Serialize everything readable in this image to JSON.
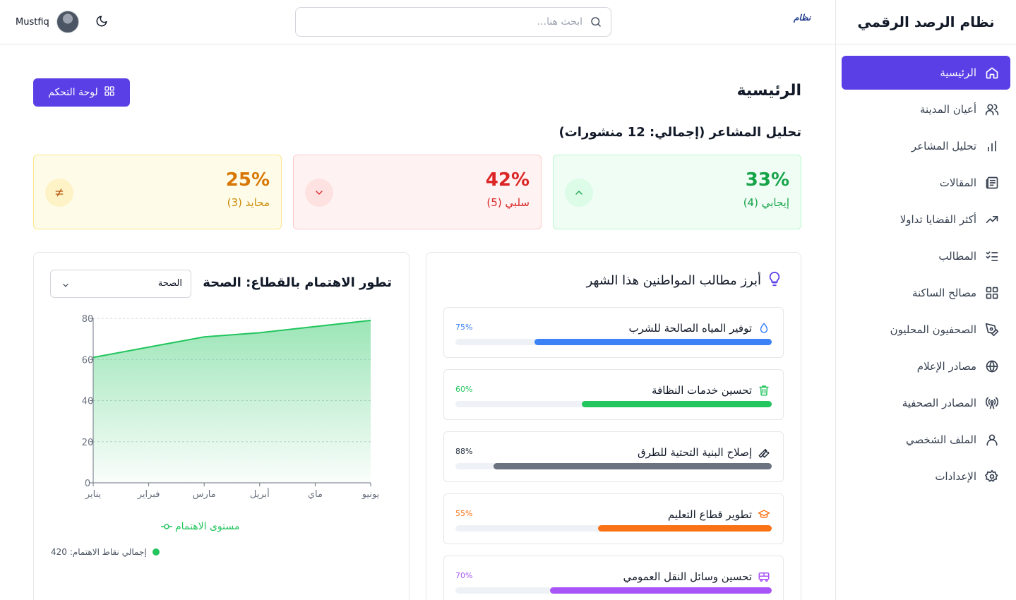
{
  "app": {
    "title": "نظام الرصد الرقمي",
    "logo_text": "نظام"
  },
  "header": {
    "search_placeholder": "ابحث هنا...",
    "user_name": "Mustfiq"
  },
  "sidebar": {
    "items": [
      {
        "label": "الرئيسية",
        "icon": "home-icon",
        "active": true
      },
      {
        "label": "أعيان المدينة",
        "icon": "users-icon"
      },
      {
        "label": "تحليل المشاعر",
        "icon": "bar-chart-icon"
      },
      {
        "label": "المقالات",
        "icon": "newspaper-icon"
      },
      {
        "label": "أكثر القضايا تداولا",
        "icon": "trending-icon"
      },
      {
        "label": "المطالب",
        "icon": "list-check-icon"
      },
      {
        "label": "مصالح الساكنة",
        "icon": "grid-icon"
      },
      {
        "label": "الصحفيون المحليون",
        "icon": "pen-icon"
      },
      {
        "label": "مصادر الإعلام",
        "icon": "globe-icon"
      },
      {
        "label": "المصادر الصحفية",
        "icon": "radio-icon"
      },
      {
        "label": "الملف الشخصي",
        "icon": "user-icon"
      },
      {
        "label": "الإعدادات",
        "icon": "gear-icon"
      }
    ]
  },
  "main": {
    "title": "الرئيسية",
    "dashboard_button": "لوحة التحكم",
    "sentiment_title": "تحليل المشاعر (إجمالي: 12 منشورات)",
    "sentiment": {
      "positive": {
        "pct": "33%",
        "label": "إيجابي (4)"
      },
      "negative": {
        "pct": "42%",
        "label": "سلبي (5)"
      },
      "neutral": {
        "pct": "25%",
        "label": "محايد (3)"
      }
    }
  },
  "demands": {
    "title": "أبرز مطالب المواطنين هذا الشهر",
    "items": [
      {
        "title": "توفير المياه الصالحة للشرب",
        "pct_label": "75%",
        "value": 75,
        "color": "#3b82f6",
        "icon": "droplet-icon"
      },
      {
        "title": "تحسين خدمات النظافة",
        "pct_label": "60%",
        "value": 60,
        "color": "#22c55e",
        "icon": "trash-icon"
      },
      {
        "title": "إصلاح البنية التحتية للطرق",
        "pct_label": "88%",
        "value": 88,
        "color": "#6b7280",
        "icon": "wrench-icon"
      },
      {
        "title": "تطوير قطاع التعليم",
        "pct_label": "55%",
        "value": 55,
        "color": "#f97316",
        "icon": "graduation-cap-icon"
      },
      {
        "title": "تحسين وسائل النقل العمومي",
        "pct_label": "70%",
        "value": 70,
        "color": "#a855f7",
        "icon": "bus-icon"
      }
    ]
  },
  "interest_chart": {
    "title": "تطور الاهتمام بالقطاع: الصحة",
    "select_value": "الصحة",
    "legend": "مستوى الاهتمام",
    "total": "إجمالي نقاط الاهتمام: 420",
    "color": "#22c55e"
  },
  "chart_data": {
    "type": "area",
    "categories": [
      "يناير",
      "فبراير",
      "مارس",
      "أبريل",
      "ماي",
      "يونيو"
    ],
    "series": [
      {
        "name": "مستوى الاهتمام",
        "values": [
          61,
          66,
          71,
          73,
          76,
          79
        ]
      }
    ],
    "ylim": [
      0,
      80
    ],
    "yticks": [
      0,
      20,
      40,
      60,
      80
    ],
    "grid": "horizontal-dashed",
    "legend_position": "bottom"
  }
}
